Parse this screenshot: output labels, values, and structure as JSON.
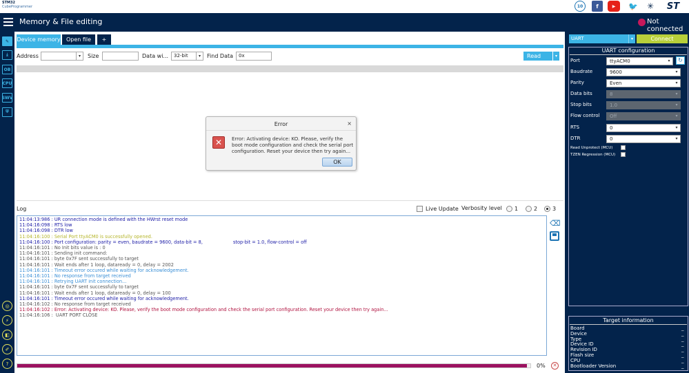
{
  "app": {
    "logo_line1": "STM32",
    "logo_line2": "CubeProgrammer",
    "title": "Memory & File editing",
    "connection_status": "Not connected",
    "anniversary_badge": "10"
  },
  "tabs": [
    {
      "label": "Device memory",
      "active": true
    },
    {
      "label": "Open file",
      "active": false
    },
    {
      "label": "+",
      "active": false
    }
  ],
  "toolbar": {
    "address_label": "Address",
    "address_value": "",
    "size_label": "Size",
    "size_value": "",
    "data_width_label": "Data wi...",
    "data_width_value": "32-bit",
    "find_label": "Find Data",
    "find_value": "0x",
    "read_label": "Read"
  },
  "sidebar": {
    "buttons": [
      "edit",
      "download",
      "OB",
      "CPU",
      "SWV",
      "security"
    ],
    "bottom_buttons": [
      "help-1",
      "help-2",
      "help-3",
      "help-4",
      "help"
    ]
  },
  "dialog": {
    "title": "Error",
    "close": "×",
    "icon": "✕",
    "message": "Error: Activating device: KO. Please, verify the boot mode configuration and check the serial port configuration. Reset your device then try again...",
    "ok_label": "OK"
  },
  "log": {
    "title": "Log",
    "live_update_label": "Live Update",
    "verbosity_label": "Verbosity level",
    "verbosity_options": [
      "1",
      "2",
      "3"
    ],
    "verbosity_selected": "3",
    "lines": [
      {
        "text": "11:04:13:986 : UR connection mode is defined with the HWrst reset mode",
        "color": "#1a1aa6"
      },
      {
        "text": "11:04:16:098 : RTS low",
        "color": "#1a1aa6"
      },
      {
        "text": "11:04:16:098 : DTR low",
        "color": "#1a1aa6"
      },
      {
        "text": "11:04:16:100 : Serial Port ttyACM0 is successfully opened.",
        "color": "#b5b52a"
      },
      {
        "text": "11:04:16:100 : Port configuration: parity = even, baudrate = 9600, data-bit = 8,                     stop-bit = 1.0, flow-control = off",
        "color": "#1a1aa6"
      },
      {
        "text": "11:04:16:101 : No Init bits value is : 0",
        "color": "#555555"
      },
      {
        "text": "11:04:16:101 : Sending init command:",
        "color": "#555555"
      },
      {
        "text": "11:04:16:101 : byte 0x7F sent successfully to target",
        "color": "#555555"
      },
      {
        "text": "11:04:16:101 : Wait ends after 1 loop, dataready = 0, delay = 2002",
        "color": "#555555"
      },
      {
        "text": "11:04:16:101 : Timeout error occured while waiting for acknowledgement.",
        "color": "#3a8fd6"
      },
      {
        "text": "11:04:16:101 : No response from target received",
        "color": "#3a8fd6"
      },
      {
        "text": "11:04:16:101 : Retrying UART init connection...",
        "color": "#3a8fd6"
      },
      {
        "text": "11:04:16:101 : byte 0x7F sent successfully to target",
        "color": "#555555"
      },
      {
        "text": "11:04:16:101 : Wait ends after 1 loop, dataready = 0, delay = 100",
        "color": "#555555"
      },
      {
        "text": "11:04:16:101 : Timeout error occured while waiting for acknowledgement.",
        "color": "#1a1aa6"
      },
      {
        "text": "11:04:16:102 : No response from target received",
        "color": "#555555"
      },
      {
        "text": "11:04:16:102 : Error: Activating device: KO. Please, verify the boot mode configuration and check the serial port configuration. Reset your device then try again...",
        "color": "#b0123f"
      },
      {
        "text": "11:04:16:106 :  UART PORT CLOSE",
        "color": "#555555"
      }
    ]
  },
  "progress": {
    "percent_text": "0%",
    "fill_fraction": 0.993
  },
  "interface": {
    "selected": "UART",
    "connect_label": "Connect"
  },
  "uart_config": {
    "title": "UART configuration",
    "fields": [
      {
        "label": "Port",
        "value": "ttyACM0",
        "disabled": false
      },
      {
        "label": "Baudrate",
        "value": "9600",
        "disabled": false
      },
      {
        "label": "Parity",
        "value": "Even",
        "disabled": false
      },
      {
        "label": "Data bits",
        "value": "8",
        "disabled": true
      },
      {
        "label": "Stop bits",
        "value": "1.0",
        "disabled": true
      },
      {
        "label": "Flow control",
        "value": "Off",
        "disabled": true
      },
      {
        "label": "RTS",
        "value": "0",
        "disabled": false
      },
      {
        "label": "DTR",
        "value": "0",
        "disabled": false
      }
    ],
    "read_unprotect_label": "Read Unprotect (MCU)",
    "tzen_label": "TZEN Regression (MCU)"
  },
  "target_info": {
    "title": "Target information",
    "rows": [
      {
        "label": "Board",
        "value": "_"
      },
      {
        "label": "Device",
        "value": "_"
      },
      {
        "label": "Type",
        "value": "_"
      },
      {
        "label": "Device ID",
        "value": "_"
      },
      {
        "label": "Revision ID",
        "value": "_"
      },
      {
        "label": "Flash size",
        "value": "_"
      },
      {
        "label": "CPU",
        "value": "_"
      },
      {
        "label": "Bootloader Version",
        "value": "_"
      }
    ]
  },
  "colors": {
    "navy": "#03234b",
    "accent": "#3cb4e6",
    "connect": "#b8cf3a",
    "status_dot": "#c6185b",
    "progress": "#9c1260"
  }
}
